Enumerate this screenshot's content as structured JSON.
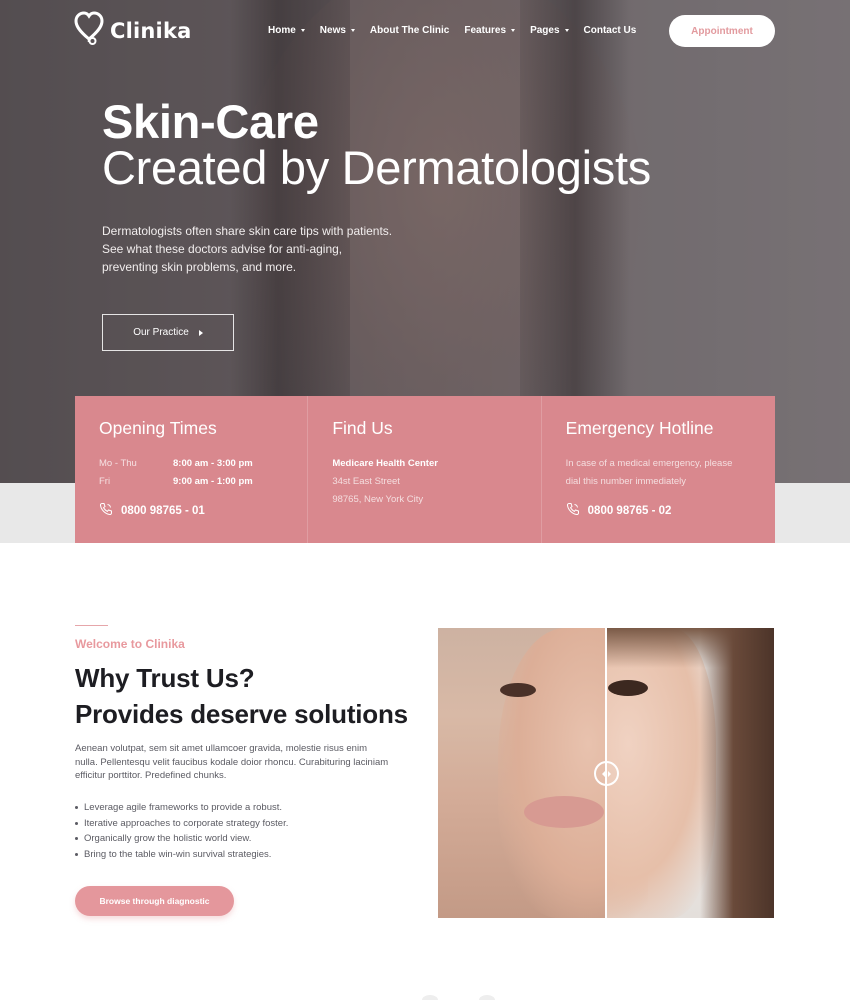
{
  "header": {
    "brand": "Clinika",
    "nav": [
      {
        "label": "Home",
        "has_dropdown": true
      },
      {
        "label": "News",
        "has_dropdown": true
      },
      {
        "label": "About The Clinic",
        "has_dropdown": false
      },
      {
        "label": "Features",
        "has_dropdown": true
      },
      {
        "label": "Pages",
        "has_dropdown": true
      },
      {
        "label": "Contact Us",
        "has_dropdown": false
      }
    ],
    "appointment_label": "Appointment"
  },
  "hero": {
    "title_line1": "Skin-Care",
    "title_line2": "Created by Dermatologists",
    "description_lines": [
      "Dermatologists often share skin care tips with patients.",
      "See what these doctors advise for anti-aging,",
      "preventing skin problems, and more."
    ],
    "cta_label": "Our Practice"
  },
  "info": {
    "opening": {
      "title": "Opening Times",
      "rows": [
        {
          "day": "Mo - Thu",
          "time": "8:00 am - 3:00 pm"
        },
        {
          "day": "Fri",
          "time": "9:00 am - 1:00 pm"
        }
      ],
      "phone": "0800 98765 - 01"
    },
    "find": {
      "title": "Find Us",
      "name": "Medicare Health Center",
      "street": "34st East Street",
      "city": "98765, New York City"
    },
    "emergency": {
      "title": "Emergency Hotline",
      "text_line1": "In case of a medical emergency, please",
      "text_line2": "dial this number immediately",
      "phone": "0800 98765 - 02"
    }
  },
  "about": {
    "kicker": "Welcome to Clinika",
    "heading_line1": "Why Trust Us?",
    "heading_line2": "Provides deserve solutions",
    "text_lines": [
      "Aenean volutpat, sem sit amet ullamcoer gravida, molestie risus enim",
      "nulla. Pellentesqu velit faucibus kodale doior rhoncu. Curabituring laciniam",
      "efficitur porttitor. Predefined chunks."
    ],
    "bullets": [
      "Leverage agile frameworks to provide a robust.",
      "Iterative approaches to corporate strategy foster.",
      "Organically grow the holistic world view.",
      "Bring to the table win-win survival strategies."
    ],
    "cta_label": "Browse through diagnostic"
  },
  "colors": {
    "accent": "#d9888e",
    "button_pink": "#e4979c",
    "kicker_pink": "#e8999e",
    "heading_dark": "#1d1d22"
  },
  "icons": {
    "logo": "heart-stethoscope-icon",
    "phone": "phone-icon",
    "dropdown": "caret-down-icon",
    "cta_arrow": "caret-right-icon",
    "slider": "slider-handle-icon"
  }
}
